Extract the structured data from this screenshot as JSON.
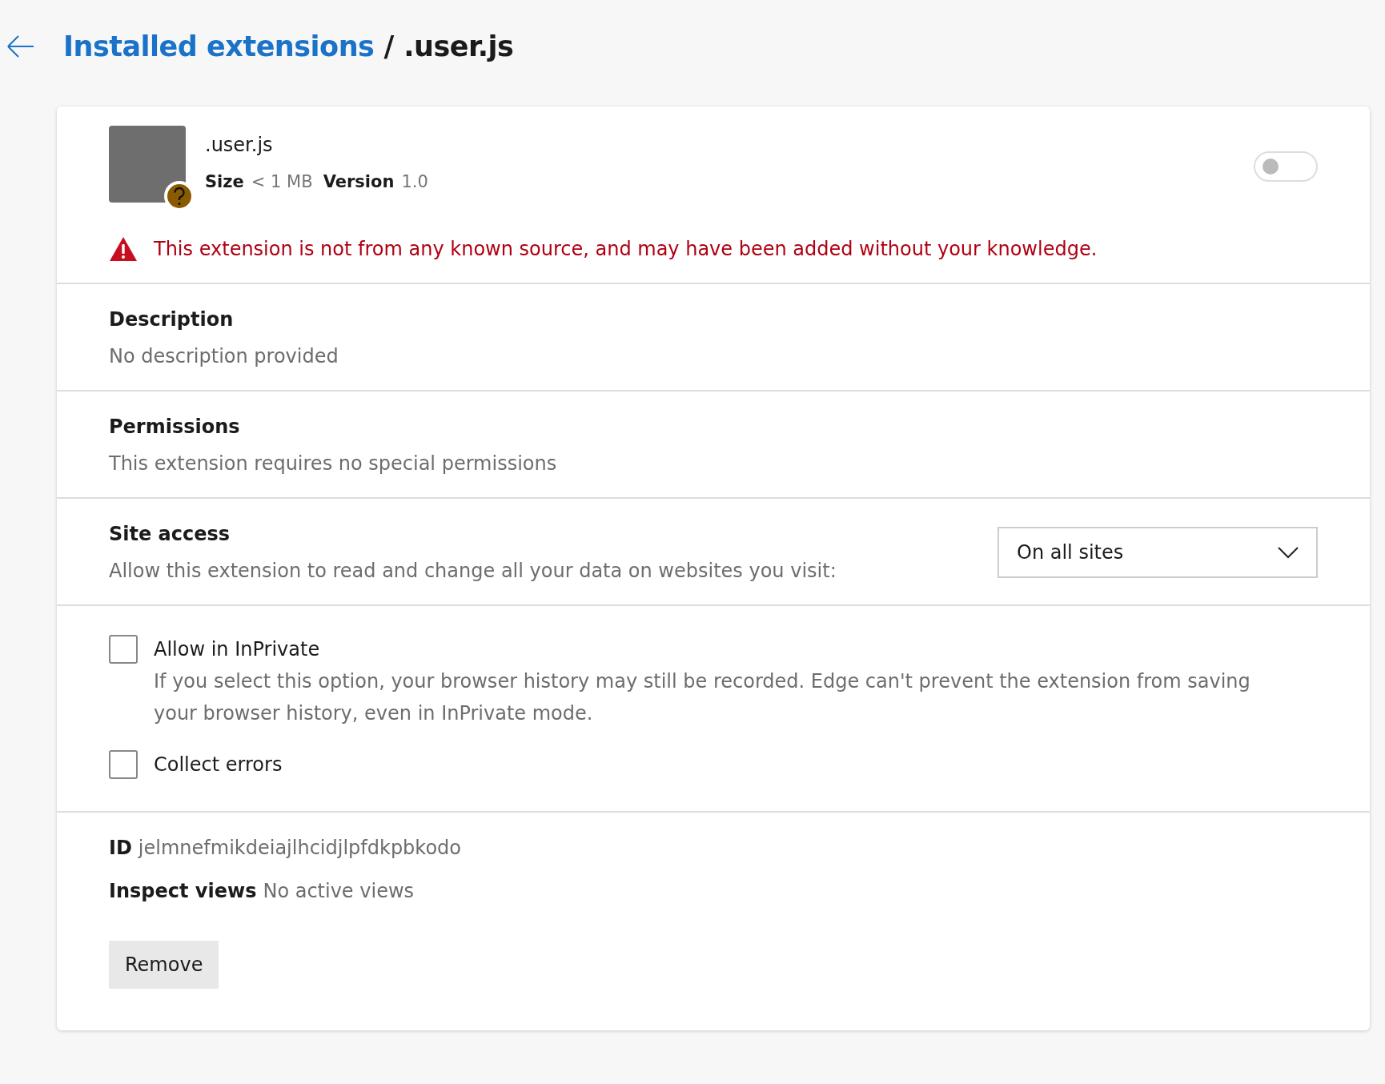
{
  "header": {
    "breadcrumb_link": "Installed extensions",
    "separator": "/",
    "current": ".user.js"
  },
  "extension": {
    "name": ".user.js",
    "size_label": "Size",
    "size": "< 1 MB",
    "version_label": "Version",
    "version": "1.0",
    "enabled": false,
    "warning": "This extension is not from any known source, and may have been added without your knowledge."
  },
  "sections": [
    {
      "title": "Description",
      "text": "No description provided"
    },
    {
      "title": "Permissions",
      "text": "This extension requires no special permissions"
    }
  ],
  "site_access": {
    "title": "Site access",
    "text": "Allow this extension to read and change all your data on websites you visit:",
    "value": "On all sites"
  },
  "options": [
    {
      "label": "Allow in InPrivate",
      "checked": false,
      "note": "If you select this option, your browser history may still be recorded. Edge can't prevent the extension from saving your browser history, even in InPrivate mode."
    },
    {
      "label": "Collect errors",
      "checked": false
    }
  ],
  "details": [
    {
      "label": "ID",
      "value": "jelmnefmikdeiajlhcidjlpfdkpbkodo"
    },
    {
      "label": "Inspect views",
      "value": "No active views"
    }
  ],
  "remove_button": "Remove"
}
